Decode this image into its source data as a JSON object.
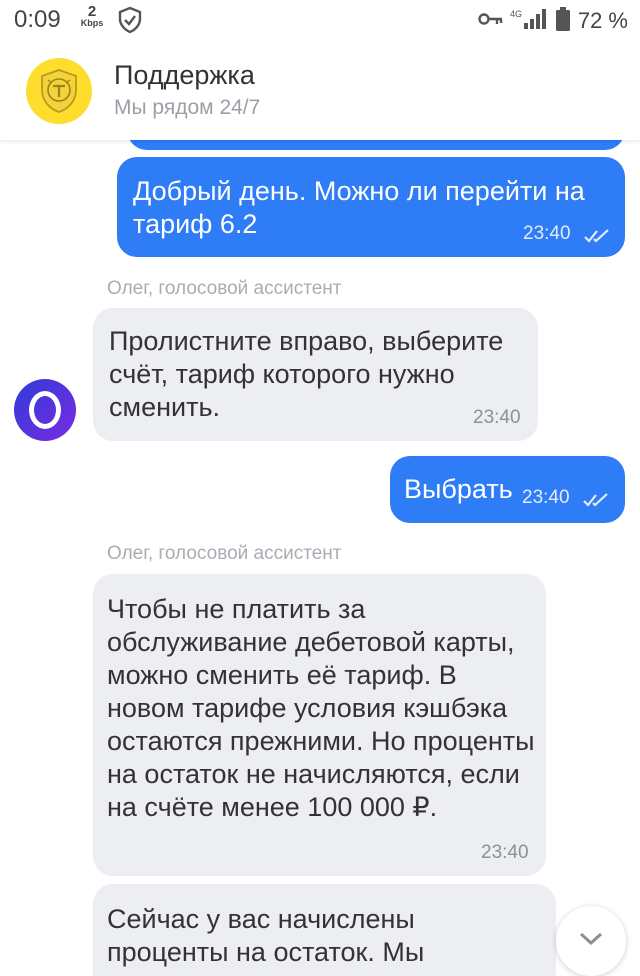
{
  "status_bar": {
    "time": "0:09",
    "speed_value": "2",
    "speed_unit": "Kbps",
    "network": "4G",
    "battery": "72 %"
  },
  "header": {
    "title": "Поддержка",
    "subtitle": "Мы рядом 24/7"
  },
  "messages": [
    {
      "direction": "out",
      "text": "Добрый день. Можно ли перейти на тариф 6.2",
      "time": "23:40"
    },
    {
      "direction": "in",
      "sender": "Олег, голосовой ассистент",
      "text": "Пролистните вправо, выберите счёт, тариф которого нужно сменить.",
      "time": "23:40"
    },
    {
      "direction": "out",
      "text": "Выбрать",
      "time": "23:40"
    },
    {
      "direction": "in",
      "sender": "Олег, голосовой ассистент",
      "text": "Чтобы не платить за обслуживание дебетовой карты, можно сменить её тариф. В новом тарифе условия кэшбэка остаются прежними. Но проценты на остаток не начисляются, если на счёте менее 100 000 ₽.",
      "time": "23:40"
    },
    {
      "direction": "in",
      "text": "Сейчас у вас начислены проценты на остаток. Мы"
    }
  ],
  "avatar_letter_icon": "o-ring-icon",
  "colors": {
    "outgoing_bubble": "#2e7cf6",
    "incoming_bubble": "#eceef1",
    "logo_yellow": "#ffdd2d"
  }
}
